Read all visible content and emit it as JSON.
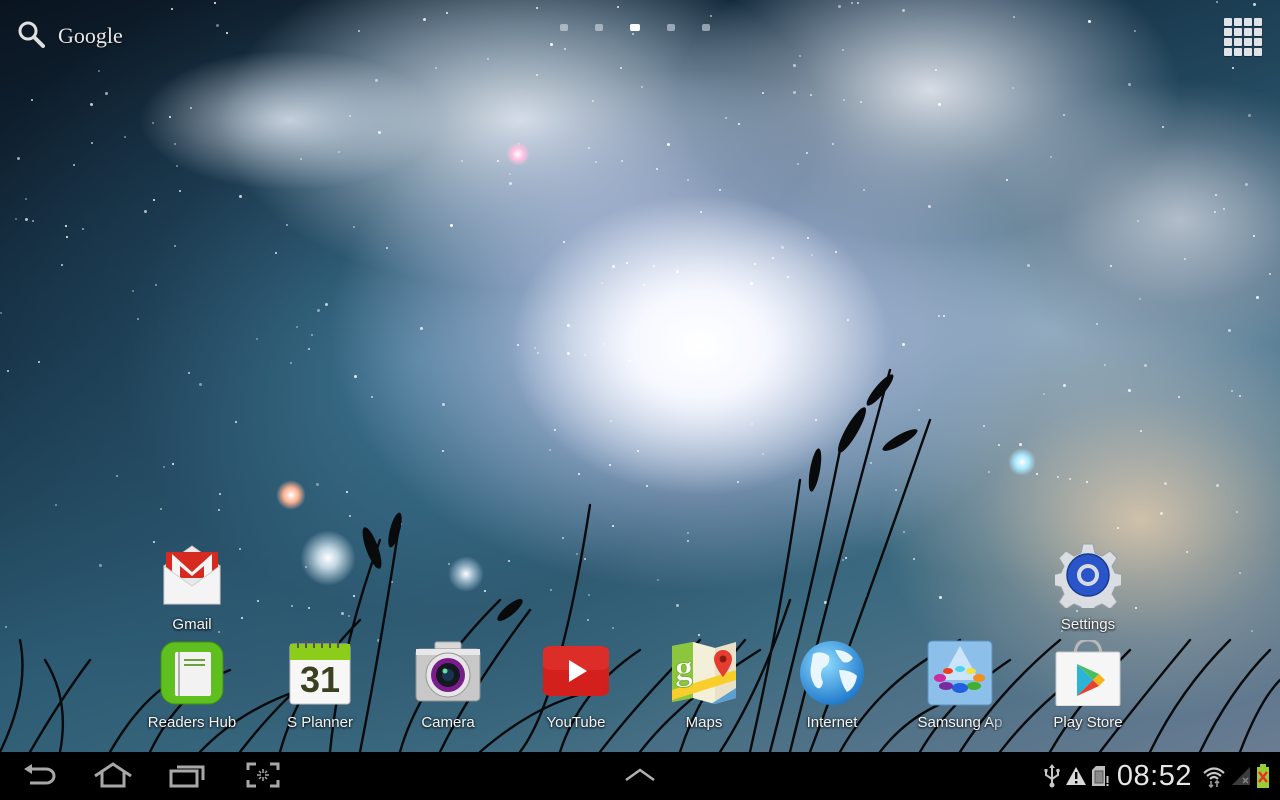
{
  "home_screen": {
    "search_widget": {
      "label": "Google",
      "icon": "search-icon"
    },
    "page_indicator": {
      "total_pages": 5,
      "current_page": 3
    },
    "app_drawer": {
      "icon": "app-grid-icon"
    },
    "apps": [
      {
        "id": "gmail",
        "label": "Gmail",
        "icon": "gmail-icon"
      },
      {
        "id": "settings",
        "label": "Settings",
        "icon": "settings-gear-icon"
      }
    ],
    "dock": [
      {
        "id": "readers-hub",
        "label": "Readers Hub",
        "icon": "book-icon"
      },
      {
        "id": "s-planner",
        "label": "S Planner",
        "icon": "calendar-icon",
        "date": "31"
      },
      {
        "id": "camera",
        "label": "Camera",
        "icon": "camera-icon"
      },
      {
        "id": "youtube",
        "label": "YouTube",
        "icon": "youtube-play-icon"
      },
      {
        "id": "maps",
        "label": "Maps",
        "icon": "maps-icon"
      },
      {
        "id": "internet",
        "label": "Internet",
        "icon": "globe-icon"
      },
      {
        "id": "samsung-apps",
        "label": "Samsung Ap",
        "icon": "samsung-apps-icon"
      },
      {
        "id": "play-store",
        "label": "Play Store",
        "icon": "play-store-bag-icon"
      }
    ]
  },
  "nav_bar": {
    "back": "back-icon",
    "home": "home-icon",
    "recents": "recent-apps-icon",
    "screenshot": "screenshot-capture-icon",
    "expand": "chevron-up-icon"
  },
  "status_bar": {
    "time": "08:52",
    "icons": [
      "usb-icon",
      "warning-icon",
      "sd-card-icon",
      "wifi-icon",
      "signal-no-service-icon",
      "battery-charging-error-icon"
    ]
  },
  "colors": {
    "nav_background": "#000000",
    "gmail_red": "#d62a20",
    "youtube_red": "#d4201c",
    "readers_hub_green": "#5fbf1f",
    "planner_green": "#8ccd1a",
    "settings_blue": "#2a55c8",
    "battery_green": "#9ccc35",
    "battery_x": "#e53030"
  }
}
